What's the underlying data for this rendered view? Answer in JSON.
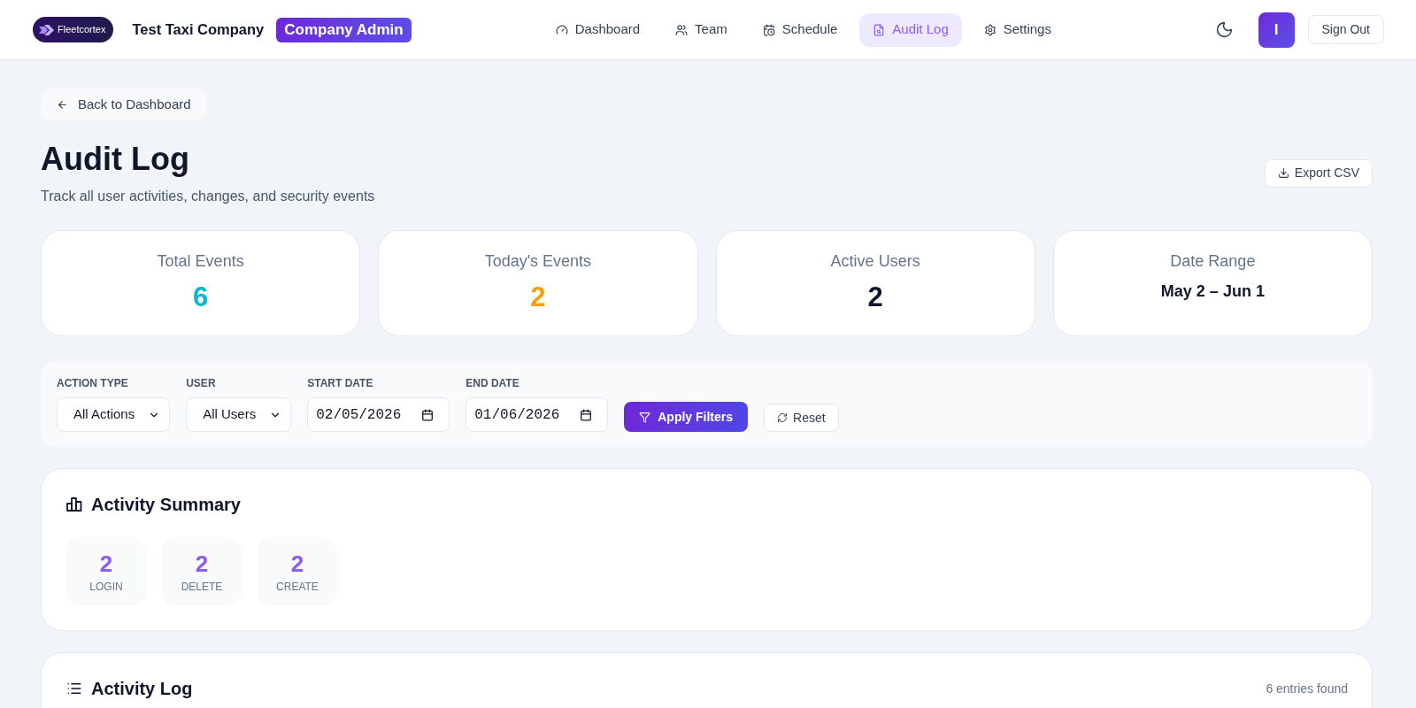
{
  "header": {
    "logo": "Fleetcortex",
    "company": "Test Taxi Company",
    "role_badge": "Company Admin",
    "nav": [
      {
        "label": "Dashboard",
        "selected": false
      },
      {
        "label": "Team",
        "selected": false
      },
      {
        "label": "Schedule",
        "selected": false
      },
      {
        "label": "Audit Log",
        "selected": true
      },
      {
        "label": "Settings",
        "selected": false
      }
    ],
    "avatar": "I",
    "sign_out": "Sign Out"
  },
  "back_link": "Back to Dashboard",
  "page_header": {
    "title": "Audit Log",
    "subtitle": "Track all user activities, changes, and security events",
    "export_button": "Export CSV"
  },
  "stats": [
    {
      "kind": "number",
      "label": "Total Events",
      "value": "6",
      "color": "#06b6d4"
    },
    {
      "kind": "number",
      "label": "Today's Events",
      "value": "2",
      "color": "#f59e0b"
    },
    {
      "kind": "number",
      "label": "Active Users",
      "value": "2",
      "color": "#0f172a"
    },
    {
      "kind": "text",
      "label": "Date Range",
      "value": "May 2 – Jun 1",
      "color": "#0f172a"
    }
  ],
  "filters": {
    "fields": [
      {
        "kind": "select",
        "label": "ACTION TYPE",
        "value": "All Actions"
      },
      {
        "kind": "select",
        "label": "USER",
        "value": "All Users"
      },
      {
        "kind": "date",
        "label": "START DATE",
        "value": "02/05/2026"
      },
      {
        "kind": "date",
        "label": "END DATE",
        "value": "01/06/2026"
      }
    ],
    "apply_button": "Apply Filters",
    "reset_button": "Reset"
  },
  "activity_summary": {
    "title": "Activity Summary",
    "items": [
      {
        "count": "2",
        "label": "LOGIN"
      },
      {
        "count": "2",
        "label": "DELETE"
      },
      {
        "count": "2",
        "label": "CREATE"
      }
    ]
  },
  "activity_log": {
    "title": "Activity Log",
    "entries_found": "6 entries found"
  }
}
